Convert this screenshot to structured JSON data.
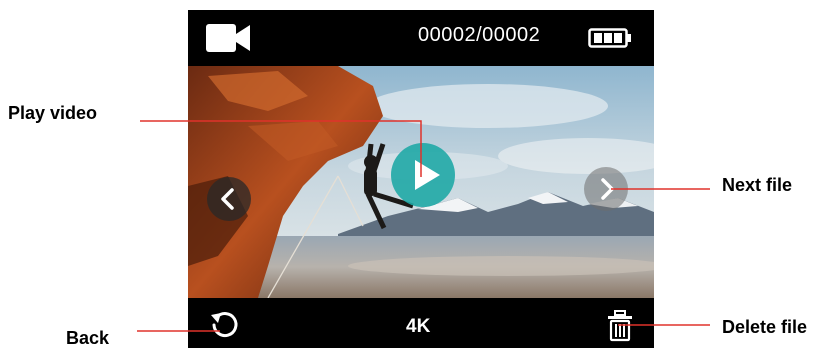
{
  "screen": {
    "topbar": {
      "mode_icon": "video-camera-icon",
      "file_counter": "00002/00002",
      "battery_icon": "battery-full-icon"
    },
    "preview": {
      "prev_icon": "chevron-left-icon",
      "next_icon": "chevron-right-icon",
      "play_icon": "play-icon",
      "play_color": "#20a8a6"
    },
    "bottombar": {
      "back_icon": "undo-arrow-icon",
      "resolution": "4K",
      "delete_icon": "trash-icon"
    }
  },
  "callouts": {
    "play": "Play video",
    "next": "Next file",
    "back": "Back",
    "delete": "Delete file",
    "line_color": "#e0322b"
  }
}
